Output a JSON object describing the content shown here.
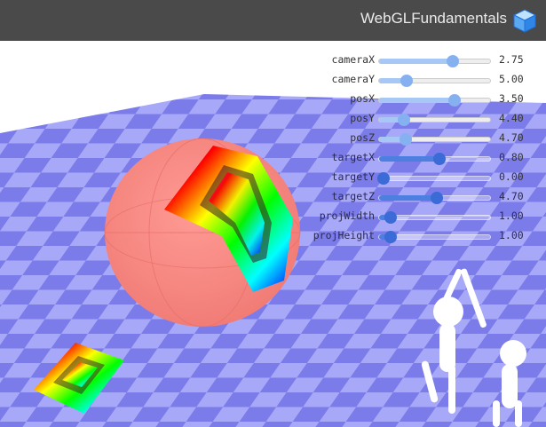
{
  "header": {
    "title": "WebGLFundamentals",
    "logo_icon": "cube-icon"
  },
  "colors": {
    "header_bg": "#4a4a4a",
    "floor_light": "#a8a8f8",
    "floor_dark": "#7b7bea",
    "sphere": "#ff8a84",
    "slider_fill": "#a7c8f5",
    "slider_thumb": "#86b1f0"
  },
  "controls": [
    {
      "label": "cameraX",
      "value": "2.75",
      "level": 0.66
    },
    {
      "label": "cameraY",
      "value": "5.00",
      "level": 0.25
    },
    {
      "label": "posX",
      "value": "3.50",
      "level": 0.68
    },
    {
      "label": "posY",
      "value": "4.40",
      "level": 0.22
    },
    {
      "label": "posZ",
      "value": "4.70",
      "level": 0.24
    },
    {
      "label": "targetX",
      "value": "0.80",
      "level": 0.54
    },
    {
      "label": "targetY",
      "value": "0.00",
      "level": 0.0
    },
    {
      "label": "targetZ",
      "value": "4.70",
      "level": 0.52
    },
    {
      "label": "projWidth",
      "value": "1.00",
      "level": 0.1
    },
    {
      "label": "projHeight",
      "value": "1.00",
      "level": 0.1
    }
  ]
}
